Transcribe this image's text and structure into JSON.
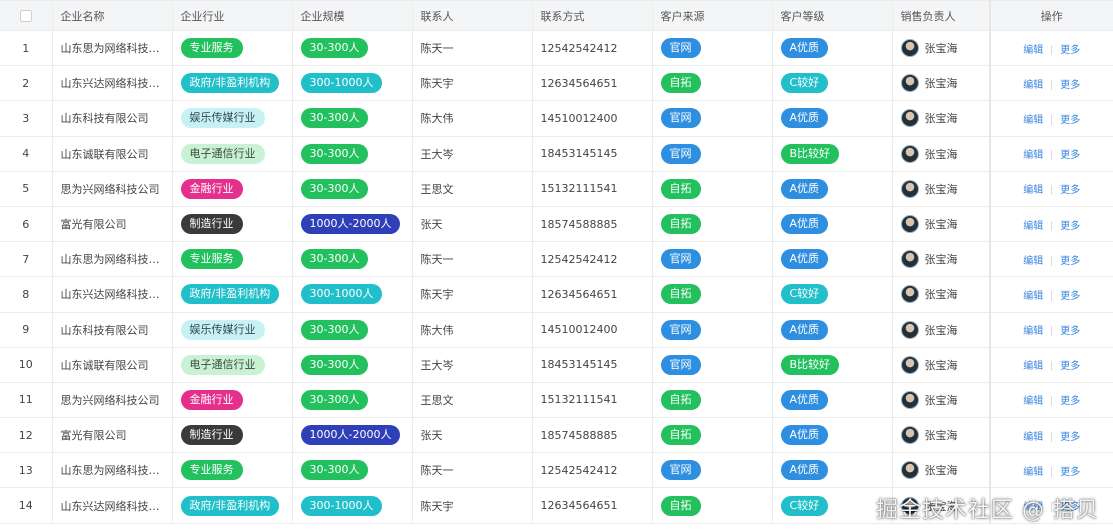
{
  "table": {
    "headers": [
      "企业名称",
      "企业行业",
      "企业规模",
      "联系人",
      "联系方式",
      "客户来源",
      "客户等级",
      "销售负责人",
      "操作"
    ],
    "ops": {
      "edit": "编辑",
      "more": "更多"
    },
    "rows": [
      {
        "idx": "1",
        "name": "山东思为网络科技有...",
        "industry": "专业服务",
        "scale": "30-300人",
        "contact": "陈天一",
        "phone": "12542542412",
        "source": "官网",
        "level": "A优质",
        "owner": "张宝海"
      },
      {
        "idx": "2",
        "name": "山东兴达网络科技有...",
        "industry": "政府/非盈利机构",
        "scale": "300-1000人",
        "contact": "陈天宇",
        "phone": "12634564651",
        "source": "自拓",
        "level": "C较好",
        "owner": "张宝海"
      },
      {
        "idx": "3",
        "name": "山东科技有限公司",
        "industry": "娱乐传媒行业",
        "scale": "30-300人",
        "contact": "陈大伟",
        "phone": "14510012400",
        "source": "官网",
        "level": "A优质",
        "owner": "张宝海"
      },
      {
        "idx": "4",
        "name": "山东诚联有限公司",
        "industry": "电子通信行业",
        "scale": "30-300人",
        "contact": "王大岑",
        "phone": "18453145145",
        "source": "官网",
        "level": "B比较好",
        "owner": "张宝海"
      },
      {
        "idx": "5",
        "name": "思为兴网络科技公司",
        "industry": "金融行业",
        "scale": "30-300人",
        "contact": "王思文",
        "phone": "15132111541",
        "source": "自拓",
        "level": "A优质",
        "owner": "张宝海"
      },
      {
        "idx": "6",
        "name": "富光有限公司",
        "industry": "制造行业",
        "scale": "1000人-2000人",
        "contact": "张天",
        "phone": "18574588885",
        "source": "自拓",
        "level": "A优质",
        "owner": "张宝海"
      },
      {
        "idx": "7",
        "name": "山东思为网络科技有...",
        "industry": "专业服务",
        "scale": "30-300人",
        "contact": "陈天一",
        "phone": "12542542412",
        "source": "官网",
        "level": "A优质",
        "owner": "张宝海"
      },
      {
        "idx": "8",
        "name": "山东兴达网络科技有...",
        "industry": "政府/非盈利机构",
        "scale": "300-1000人",
        "contact": "陈天宇",
        "phone": "12634564651",
        "source": "自拓",
        "level": "C较好",
        "owner": "张宝海"
      },
      {
        "idx": "9",
        "name": "山东科技有限公司",
        "industry": "娱乐传媒行业",
        "scale": "30-300人",
        "contact": "陈大伟",
        "phone": "14510012400",
        "source": "官网",
        "level": "A优质",
        "owner": "张宝海"
      },
      {
        "idx": "10",
        "name": "山东诚联有限公司",
        "industry": "电子通信行业",
        "scale": "30-300人",
        "contact": "王大岑",
        "phone": "18453145145",
        "source": "官网",
        "level": "B比较好",
        "owner": "张宝海"
      },
      {
        "idx": "11",
        "name": "思为兴网络科技公司",
        "industry": "金融行业",
        "scale": "30-300人",
        "contact": "王思文",
        "phone": "15132111541",
        "source": "自拓",
        "level": "A优质",
        "owner": "张宝海"
      },
      {
        "idx": "12",
        "name": "富光有限公司",
        "industry": "制造行业",
        "scale": "1000人-2000人",
        "contact": "张天",
        "phone": "18574588885",
        "source": "自拓",
        "level": "A优质",
        "owner": "张宝海"
      },
      {
        "idx": "13",
        "name": "山东思为网络科技有...",
        "industry": "专业服务",
        "scale": "30-300人",
        "contact": "陈天一",
        "phone": "12542542412",
        "source": "官网",
        "level": "A优质",
        "owner": "张宝海"
      },
      {
        "idx": "14",
        "name": "山东兴达网络科技有...",
        "industry": "政府/非盈利机构",
        "scale": "300-1000人",
        "contact": "陈天宇",
        "phone": "12634564651",
        "source": "自拓",
        "level": "C较好",
        "owner": "张宝海"
      }
    ]
  },
  "tag_colors": {
    "industry": {
      "专业服务": {
        "bg": "#22c15e",
        "fg": "#ffffff"
      },
      "政府/非盈利机构": {
        "bg": "#20bfc9",
        "fg": "#ffffff"
      },
      "娱乐传媒行业": {
        "bg": "#c7f1f4",
        "fg": "#2f4b55"
      },
      "电子通信行业": {
        "bg": "#c9f2d4",
        "fg": "#3b4a3f"
      },
      "金融行业": {
        "bg": "#e52f8c",
        "fg": "#ffffff"
      },
      "制造行业": {
        "bg": "#3a3a3a",
        "fg": "#ffffff"
      }
    },
    "scale": {
      "30-300人": {
        "bg": "#22c15e",
        "fg": "#ffffff"
      },
      "300-1000人": {
        "bg": "#20bfc9",
        "fg": "#ffffff"
      },
      "1000人-2000人": {
        "bg": "#2f3fb8",
        "fg": "#ffffff"
      }
    },
    "source": {
      "官网": {
        "bg": "#2e8fe0",
        "fg": "#ffffff"
      },
      "自拓": {
        "bg": "#22c15e",
        "fg": "#ffffff"
      }
    },
    "level": {
      "A优质": {
        "bg": "#2e8fe0",
        "fg": "#ffffff"
      },
      "B比较好": {
        "bg": "#22c15e",
        "fg": "#ffffff"
      },
      "C较好": {
        "bg": "#20bfc9",
        "fg": "#ffffff"
      }
    }
  },
  "watermark": "掘金技术社区 @ 搭贝"
}
